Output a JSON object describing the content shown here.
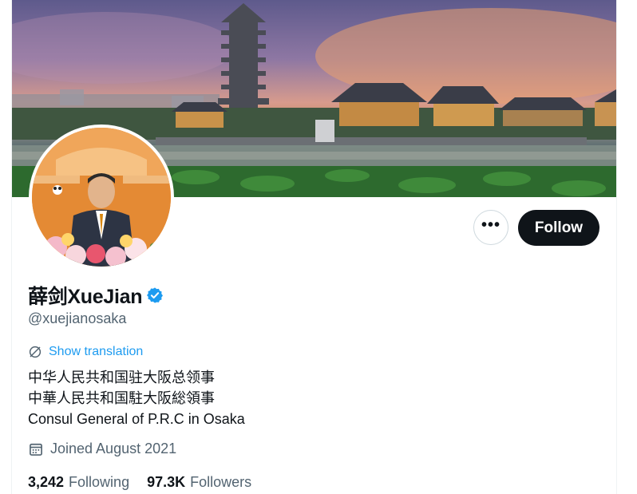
{
  "profile": {
    "display_name": "薛剑XueJian",
    "handle": "@xuejianosaka",
    "show_translation_label": "Show translation",
    "bio_lines": [
      "中华人民共和国驻大阪总领事",
      "中華人民共和国駐大阪総領事",
      "Consul General of P.R.C  in Osaka"
    ],
    "joined": "Joined August 2021",
    "following_count": "3,242",
    "following_label": "Following",
    "followers_count": "97.3K",
    "followers_label": "Followers"
  },
  "actions": {
    "more_label": "•••",
    "follow_label": "Follow"
  },
  "icons": {
    "verified": "verified-badge-icon",
    "translate": "globe-translate-icon",
    "calendar": "calendar-icon",
    "more": "more-dots-icon"
  },
  "colors": {
    "verified_blue": "#1d9bf0",
    "link_blue": "#1d9bf0",
    "follow_bg": "#0f1419",
    "secondary_text": "#536471"
  }
}
